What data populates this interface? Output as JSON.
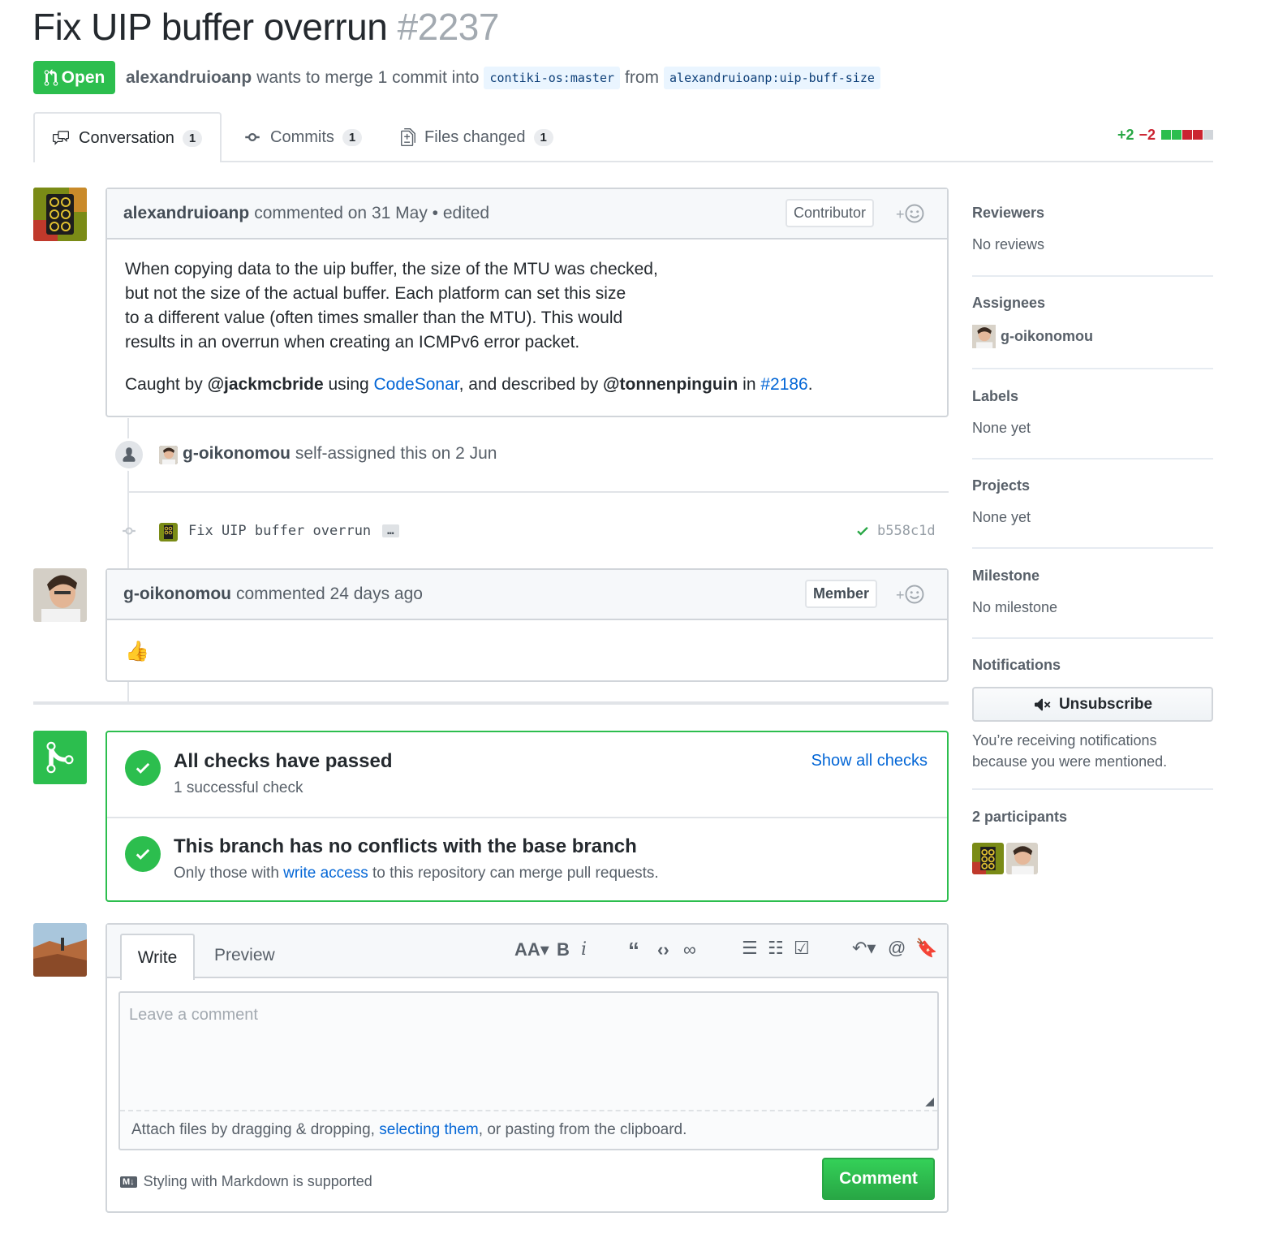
{
  "pr": {
    "title": "Fix UIP buffer overrun",
    "number": "#2237",
    "state": "Open",
    "author": "alexandruioanp",
    "merge_text": "wants to merge 1 commit into",
    "base": "contiki-os:master",
    "from": "from",
    "head": "alexandruioanp:uip-buff-size"
  },
  "tabs": [
    {
      "label": "Conversation",
      "count": "1"
    },
    {
      "label": "Commits",
      "count": "1"
    },
    {
      "label": "Files changed",
      "count": "1"
    }
  ],
  "diffstat": {
    "additions": "+2",
    "deletions": "−2"
  },
  "comment1": {
    "author": "alexandruioanp",
    "meta": "commented on 31 May • edited",
    "role": "Contributor",
    "line1": "When copying data to the uip buffer, the size of the MTU was checked,",
    "line2": "but not the size of the actual buffer. Each platform can set this size",
    "line3": "to a different value (often times smaller than the MTU). This would",
    "line4": "results in an overrun when creating an ICMPv6 error packet.",
    "caught_prefix": "Caught by ",
    "mention1": "@jackmcbride",
    "using": " using ",
    "tool": "CodeSonar",
    "described": ", and described by ",
    "mention2": "@tonnenpinguin",
    "in": " in ",
    "issue": "#2186",
    "period": "."
  },
  "event": {
    "user": "g-oikonomou",
    "text": "self-assigned this on 2 Jun"
  },
  "commit": {
    "message": "Fix UIP buffer overrun",
    "ellipsis": "…",
    "sha": "b558c1d"
  },
  "comment2": {
    "author": "g-oikonomou",
    "meta": "commented 24 days ago",
    "role": "Member",
    "body": "👍"
  },
  "merge": {
    "checks_title": "All checks have passed",
    "checks_sub": "1 successful check",
    "show_checks": "Show all checks",
    "conflict_title": "This branch has no conflicts with the base branch",
    "conflict_pre": "Only those with ",
    "conflict_link": "write access",
    "conflict_post": " to this repository can merge pull requests."
  },
  "editor": {
    "tab_write": "Write",
    "tab_preview": "Preview",
    "placeholder": "Leave a comment",
    "attach_pre": "Attach files by dragging & dropping, ",
    "attach_link": "selecting them",
    "attach_post": ", or pasting from the clipboard.",
    "markdown": "Styling with Markdown is supported",
    "submit": "Comment",
    "md_badge": "M↓"
  },
  "sidebar": {
    "reviewers_h": "Reviewers",
    "reviewers_v": "No reviews",
    "assignees_h": "Assignees",
    "assignee": "g-oikonomou",
    "labels_h": "Labels",
    "labels_v": "None yet",
    "projects_h": "Projects",
    "projects_v": "None yet",
    "milestone_h": "Milestone",
    "milestone_v": "No milestone",
    "notifications_h": "Notifications",
    "unsubscribe": "Unsubscribe",
    "notif_text1": "You’re receiving notifications",
    "notif_text2": "because you were mentioned.",
    "participants": "2 participants"
  },
  "colors": {
    "green": "#2cbe4e",
    "link": "#0366d6",
    "red": "#cb2431"
  }
}
